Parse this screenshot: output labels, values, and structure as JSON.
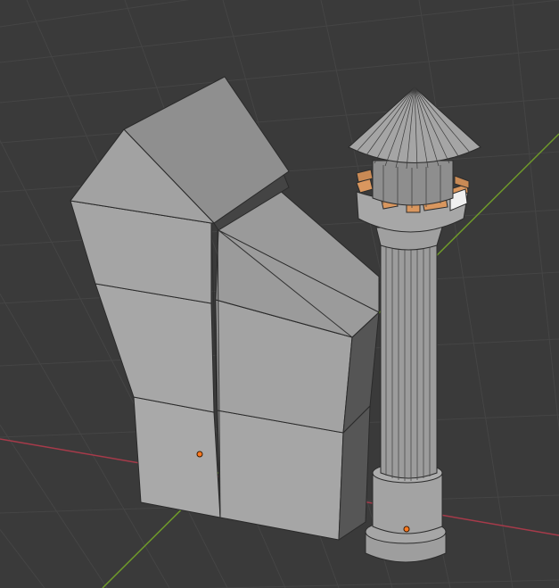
{
  "viewport": {
    "background": "#3a3a3a",
    "grid_color": "#444444",
    "x_axis_color": "#a63a4a",
    "y_axis_color": "#6f9a2a"
  },
  "scene": {
    "objects": [
      {
        "name": "broken-wall",
        "shading": "solid-gray",
        "origin_color": "#ff7a20"
      },
      {
        "name": "tower",
        "shading": "solid-gray",
        "origin_color": "#ff7a20",
        "selected_faces_color": "#d9975f"
      }
    ]
  }
}
